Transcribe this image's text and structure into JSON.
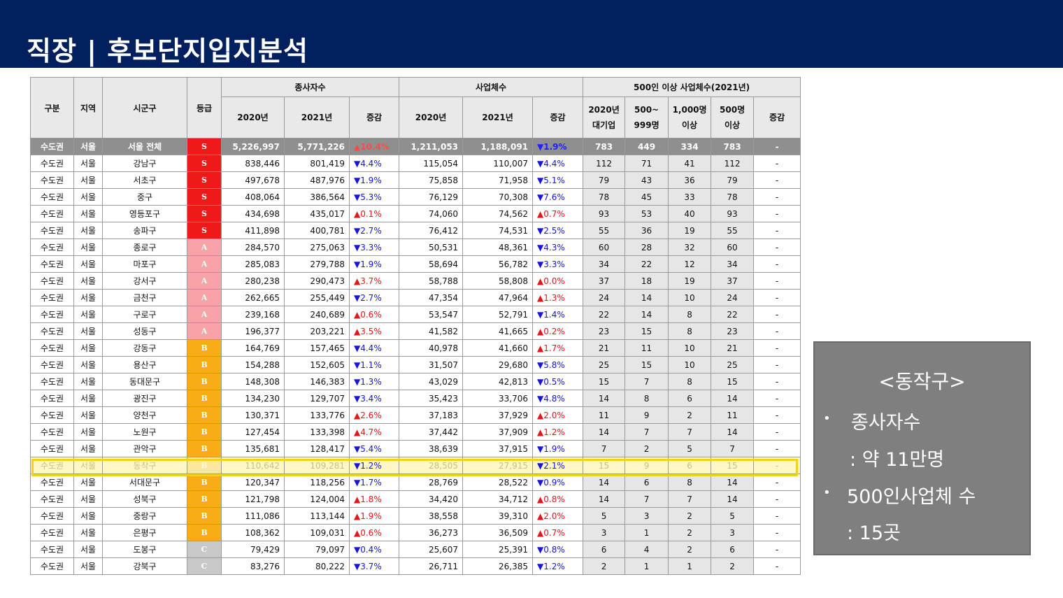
{
  "header": {
    "title": "직장   |   후보단지입지분석",
    "bg_color": "#02205e"
  },
  "table": {
    "group_headers": {
      "region_group": "구분",
      "region": "지역",
      "district": "시군구",
      "grade": "등급",
      "employees": "종사자수",
      "businesses": "사업체수",
      "large_biz": "500인 이상 사업체수(2021년)"
    },
    "sub_headers": {
      "emp_2020": "2020년",
      "emp_2021": "2021년",
      "emp_change": "증감",
      "biz_2020": "2020년",
      "biz_2021": "2021년",
      "biz_change": "증감",
      "lb_2020_l1": "2020년",
      "lb_2020_l2": "대기업",
      "lb_500_l1": "500~",
      "lb_500_l2": "999명",
      "lb_1000_l1": "1,000명",
      "lb_1000_l2": "이상",
      "lb_over_l1": "500명",
      "lb_over_l2": "이상",
      "lb_change": "증감"
    },
    "grade_colors": {
      "S": "#f01818",
      "A": "#f7a3a8",
      "B": "#f8ad17",
      "C": "#c8c8c8"
    },
    "highlighted_district": "동작구",
    "rows": [
      {
        "g": "수도권",
        "r": "서울",
        "d": "서울 전체",
        "gr": "S",
        "e20": "5,226,997",
        "e21": "5,771,226",
        "ec": "▲10.4%",
        "ed": "up",
        "b20": "1,211,053",
        "b21": "1,188,091",
        "bc": "▼1.9%",
        "bd": "down",
        "l1": "783",
        "l2": "449",
        "l3": "334",
        "l4": "783",
        "l5": "-",
        "total": true
      },
      {
        "g": "수도권",
        "r": "서울",
        "d": "강남구",
        "gr": "S",
        "e20": "838,446",
        "e21": "801,419",
        "ec": "▼4.4%",
        "ed": "down",
        "b20": "115,054",
        "b21": "110,007",
        "bc": "▼4.4%",
        "bd": "down",
        "l1": "112",
        "l2": "71",
        "l3": "41",
        "l4": "112",
        "l5": "-"
      },
      {
        "g": "수도권",
        "r": "서울",
        "d": "서초구",
        "gr": "S",
        "e20": "497,678",
        "e21": "487,976",
        "ec": "▼1.9%",
        "ed": "down",
        "b20": "75,858",
        "b21": "71,958",
        "bc": "▼5.1%",
        "bd": "down",
        "l1": "79",
        "l2": "43",
        "l3": "36",
        "l4": "79",
        "l5": "-"
      },
      {
        "g": "수도권",
        "r": "서울",
        "d": "중구",
        "gr": "S",
        "e20": "408,064",
        "e21": "386,564",
        "ec": "▼5.3%",
        "ed": "down",
        "b20": "76,129",
        "b21": "70,308",
        "bc": "▼7.6%",
        "bd": "down",
        "l1": "78",
        "l2": "45",
        "l3": "33",
        "l4": "78",
        "l5": "-"
      },
      {
        "g": "수도권",
        "r": "서울",
        "d": "영등포구",
        "gr": "S",
        "e20": "434,698",
        "e21": "435,017",
        "ec": "▲0.1%",
        "ed": "up",
        "b20": "74,060",
        "b21": "74,562",
        "bc": "▲0.7%",
        "bd": "up",
        "l1": "93",
        "l2": "53",
        "l3": "40",
        "l4": "93",
        "l5": "-"
      },
      {
        "g": "수도권",
        "r": "서울",
        "d": "송파구",
        "gr": "S",
        "e20": "411,898",
        "e21": "400,781",
        "ec": "▼2.7%",
        "ed": "down",
        "b20": "76,412",
        "b21": "74,531",
        "bc": "▼2.5%",
        "bd": "down",
        "l1": "55",
        "l2": "36",
        "l3": "19",
        "l4": "55",
        "l5": "-"
      },
      {
        "g": "수도권",
        "r": "서울",
        "d": "종로구",
        "gr": "A",
        "e20": "284,570",
        "e21": "275,063",
        "ec": "▼3.3%",
        "ed": "down",
        "b20": "50,531",
        "b21": "48,361",
        "bc": "▼4.3%",
        "bd": "down",
        "l1": "60",
        "l2": "28",
        "l3": "32",
        "l4": "60",
        "l5": "-"
      },
      {
        "g": "수도권",
        "r": "서울",
        "d": "마포구",
        "gr": "A",
        "e20": "285,083",
        "e21": "279,788",
        "ec": "▼1.9%",
        "ed": "down",
        "b20": "58,694",
        "b21": "56,782",
        "bc": "▼3.3%",
        "bd": "down",
        "l1": "34",
        "l2": "22",
        "l3": "12",
        "l4": "34",
        "l5": "-"
      },
      {
        "g": "수도권",
        "r": "서울",
        "d": "강서구",
        "gr": "A",
        "e20": "280,238",
        "e21": "290,473",
        "ec": "▲3.7%",
        "ed": "up",
        "b20": "58,788",
        "b21": "58,808",
        "bc": "▲0.0%",
        "bd": "up",
        "l1": "37",
        "l2": "18",
        "l3": "19",
        "l4": "37",
        "l5": "-"
      },
      {
        "g": "수도권",
        "r": "서울",
        "d": "금천구",
        "gr": "A",
        "e20": "262,665",
        "e21": "255,449",
        "ec": "▼2.7%",
        "ed": "down",
        "b20": "47,354",
        "b21": "47,964",
        "bc": "▲1.3%",
        "bd": "up",
        "l1": "24",
        "l2": "14",
        "l3": "10",
        "l4": "24",
        "l5": "-"
      },
      {
        "g": "수도권",
        "r": "서울",
        "d": "구로구",
        "gr": "A",
        "e20": "239,168",
        "e21": "240,689",
        "ec": "▲0.6%",
        "ed": "up",
        "b20": "53,547",
        "b21": "52,791",
        "bc": "▼1.4%",
        "bd": "down",
        "l1": "22",
        "l2": "14",
        "l3": "8",
        "l4": "22",
        "l5": "-"
      },
      {
        "g": "수도권",
        "r": "서울",
        "d": "성동구",
        "gr": "A",
        "e20": "196,377",
        "e21": "203,221",
        "ec": "▲3.5%",
        "ed": "up",
        "b20": "41,582",
        "b21": "41,665",
        "bc": "▲0.2%",
        "bd": "up",
        "l1": "23",
        "l2": "15",
        "l3": "8",
        "l4": "23",
        "l5": "-"
      },
      {
        "g": "수도권",
        "r": "서울",
        "d": "강동구",
        "gr": "B",
        "e20": "164,769",
        "e21": "157,465",
        "ec": "▼4.4%",
        "ed": "down",
        "b20": "40,978",
        "b21": "41,660",
        "bc": "▲1.7%",
        "bd": "up",
        "l1": "21",
        "l2": "11",
        "l3": "10",
        "l4": "21",
        "l5": "-"
      },
      {
        "g": "수도권",
        "r": "서울",
        "d": "용산구",
        "gr": "B",
        "e20": "154,288",
        "e21": "152,605",
        "ec": "▼1.1%",
        "ed": "down",
        "b20": "31,507",
        "b21": "29,680",
        "bc": "▼5.8%",
        "bd": "down",
        "l1": "25",
        "l2": "15",
        "l3": "10",
        "l4": "25",
        "l5": "-"
      },
      {
        "g": "수도권",
        "r": "서울",
        "d": "동대문구",
        "gr": "B",
        "e20": "148,308",
        "e21": "146,383",
        "ec": "▼1.3%",
        "ed": "down",
        "b20": "43,029",
        "b21": "42,813",
        "bc": "▼0.5%",
        "bd": "down",
        "l1": "15",
        "l2": "7",
        "l3": "8",
        "l4": "15",
        "l5": "-"
      },
      {
        "g": "수도권",
        "r": "서울",
        "d": "광진구",
        "gr": "B",
        "e20": "134,230",
        "e21": "129,707",
        "ec": "▼3.4%",
        "ed": "down",
        "b20": "35,423",
        "b21": "33,706",
        "bc": "▼4.8%",
        "bd": "down",
        "l1": "14",
        "l2": "8",
        "l3": "6",
        "l4": "14",
        "l5": "-"
      },
      {
        "g": "수도권",
        "r": "서울",
        "d": "양천구",
        "gr": "B",
        "e20": "130,371",
        "e21": "133,776",
        "ec": "▲2.6%",
        "ed": "up",
        "b20": "37,183",
        "b21": "37,929",
        "bc": "▲2.0%",
        "bd": "up",
        "l1": "11",
        "l2": "9",
        "l3": "2",
        "l4": "11",
        "l5": "-"
      },
      {
        "g": "수도권",
        "r": "서울",
        "d": "노원구",
        "gr": "B",
        "e20": "127,454",
        "e21": "133,398",
        "ec": "▲4.7%",
        "ed": "up",
        "b20": "37,442",
        "b21": "37,909",
        "bc": "▲1.2%",
        "bd": "up",
        "l1": "14",
        "l2": "7",
        "l3": "7",
        "l4": "14",
        "l5": "-"
      },
      {
        "g": "수도권",
        "r": "서울",
        "d": "관악구",
        "gr": "B",
        "e20": "135,681",
        "e21": "128,417",
        "ec": "▼5.4%",
        "ed": "down",
        "b20": "38,639",
        "b21": "37,915",
        "bc": "▼1.9%",
        "bd": "down",
        "l1": "7",
        "l2": "2",
        "l3": "5",
        "l4": "7",
        "l5": "-"
      },
      {
        "g": "수도권",
        "r": "서울",
        "d": "동작구",
        "gr": "B",
        "e20": "110,642",
        "e21": "109,281",
        "ec": "▼1.2%",
        "ed": "down",
        "b20": "28,505",
        "b21": "27,915",
        "bc": "▼2.1%",
        "bd": "down",
        "l1": "15",
        "l2": "9",
        "l3": "6",
        "l4": "15",
        "l5": "-",
        "highlight": true
      },
      {
        "g": "수도권",
        "r": "서울",
        "d": "서대문구",
        "gr": "B",
        "e20": "120,347",
        "e21": "118,256",
        "ec": "▼1.7%",
        "ed": "down",
        "b20": "28,769",
        "b21": "28,522",
        "bc": "▼0.9%",
        "bd": "down",
        "l1": "14",
        "l2": "6",
        "l3": "8",
        "l4": "14",
        "l5": "-"
      },
      {
        "g": "수도권",
        "r": "서울",
        "d": "성북구",
        "gr": "B",
        "e20": "121,798",
        "e21": "124,004",
        "ec": "▲1.8%",
        "ed": "up",
        "b20": "34,420",
        "b21": "34,712",
        "bc": "▲0.8%",
        "bd": "up",
        "l1": "14",
        "l2": "7",
        "l3": "7",
        "l4": "14",
        "l5": "-"
      },
      {
        "g": "수도권",
        "r": "서울",
        "d": "중랑구",
        "gr": "B",
        "e20": "111,086",
        "e21": "113,144",
        "ec": "▲1.9%",
        "ed": "up",
        "b20": "38,558",
        "b21": "39,310",
        "bc": "▲2.0%",
        "bd": "up",
        "l1": "5",
        "l2": "3",
        "l3": "2",
        "l4": "5",
        "l5": "-"
      },
      {
        "g": "수도권",
        "r": "서울",
        "d": "은평구",
        "gr": "B",
        "e20": "108,362",
        "e21": "109,031",
        "ec": "▲0.6%",
        "ed": "up",
        "b20": "36,273",
        "b21": "36,509",
        "bc": "▲0.7%",
        "bd": "up",
        "l1": "3",
        "l2": "1",
        "l3": "2",
        "l4": "3",
        "l5": "-"
      },
      {
        "g": "수도권",
        "r": "서울",
        "d": "도봉구",
        "gr": "C",
        "e20": "79,429",
        "e21": "79,097",
        "ec": "▼0.4%",
        "ed": "down",
        "b20": "25,607",
        "b21": "25,391",
        "bc": "▼0.8%",
        "bd": "down",
        "l1": "6",
        "l2": "4",
        "l3": "2",
        "l4": "6",
        "l5": "-"
      },
      {
        "g": "수도권",
        "r": "서울",
        "d": "강북구",
        "gr": "C",
        "e20": "83,276",
        "e21": "80,222",
        "ec": "▼3.7%",
        "ed": "down",
        "b20": "26,711",
        "b21": "26,385",
        "bc": "▼1.2%",
        "bd": "down",
        "l1": "2",
        "l2": "1",
        "l3": "1",
        "l4": "2",
        "l5": "-"
      }
    ]
  },
  "note": {
    "title": "<동작구>",
    "bullet": "•",
    "item1_label": "종사자수",
    "item1_value": ": 약 11만명",
    "item2_label": "500인사업체 수",
    "item2_value": ": 15곳"
  }
}
